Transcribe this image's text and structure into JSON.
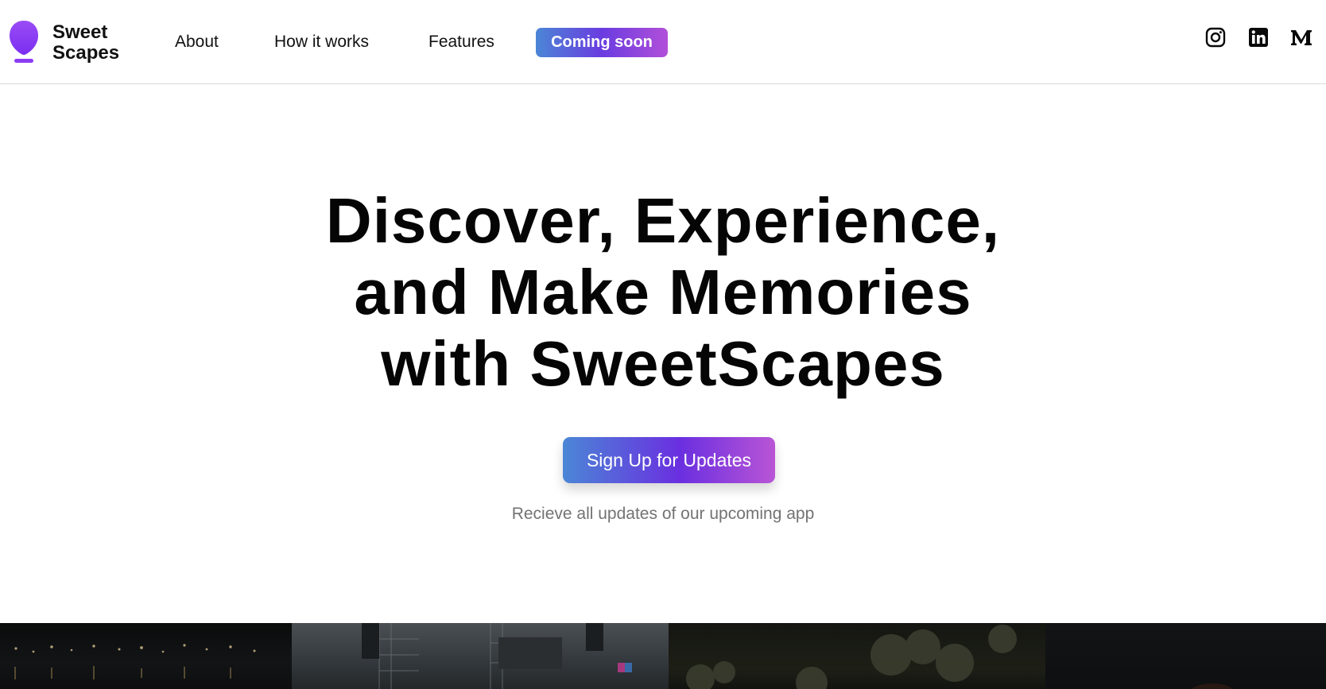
{
  "brand": {
    "name_line1": "Sweet",
    "name_line2": "Scapes",
    "logo_color": "#8b3cf3"
  },
  "nav": {
    "about": "About",
    "how_it_works": "How it works",
    "features": "Features",
    "coming_soon": "Coming soon"
  },
  "socials": [
    {
      "name": "instagram-icon"
    },
    {
      "name": "linkedin-icon"
    },
    {
      "name": "medium-icon"
    }
  ],
  "hero": {
    "title_line1": "Discover, Experience,",
    "title_line2": "and Make Memories",
    "title_line3": "with SweetScapes",
    "cta_label": "Sign Up for Updates",
    "subtext": "Recieve all updates of our upcoming app"
  },
  "colors": {
    "gradient_start": "#4b86d6",
    "gradient_mid": "#6a2fe0",
    "gradient_end": "#b955d6"
  }
}
